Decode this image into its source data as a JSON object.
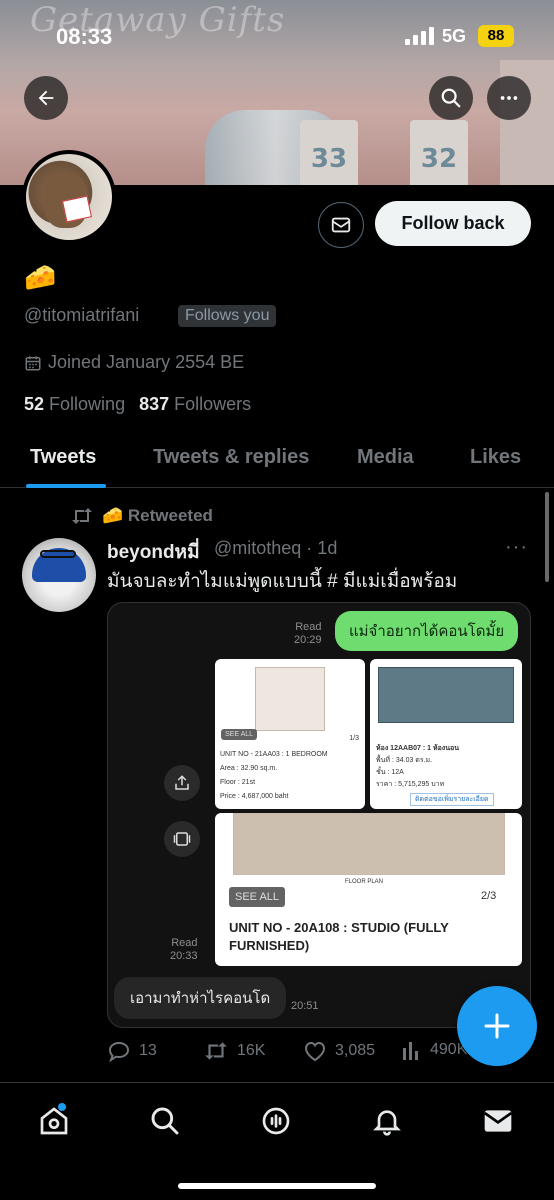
{
  "status_bar": {
    "time": "08:33",
    "network": "5G",
    "battery": "88"
  },
  "banner": {
    "sign_text": "Getaway Gifts",
    "pillar_left": "33",
    "pillar_right": "32"
  },
  "profile": {
    "display_name": "🧀",
    "handle": "@titomiatrifani",
    "follows_you": "Follows you",
    "joined": "Joined January 2554 BE",
    "following_count": "52",
    "following_label": "Following",
    "followers_count": "837",
    "followers_label": "Followers",
    "follow_button": "Follow back"
  },
  "tabs": [
    {
      "label": "Tweets"
    },
    {
      "label": "Tweets & replies"
    },
    {
      "label": "Media"
    },
    {
      "label": "Likes"
    }
  ],
  "tweet": {
    "retweeted_label": "🧀 Retweeted",
    "author_name": "beyondหมี่",
    "author_meta": "@mitotheq · 1d",
    "more": "···",
    "text": "มันจบละทำไมแม่พูดแบบนี้ # มีแม่เมื่อพร้อม",
    "media": {
      "green_bubble": "แม่จำอยากได้คอนโดมั้ย",
      "read1_label": "Read",
      "read1_time": "20:29",
      "doc1": {
        "see_all": "SEE ALL",
        "unit": "UNIT NO - 21AA03 : 1 BEDROOM",
        "area": "Area : 32.90 sq.m.",
        "floor": "Floor : 21st",
        "price": "Price : 4,687,000 baht",
        "page": "1/3"
      },
      "doc2": {
        "room": "ห้อง 12AAB07 : 1 ห้องนอน",
        "area": "พื้นที่ : 34.03 ตร.ม.",
        "floor": "ชั้น : 12A",
        "price": "ราคา : 5,715,295 บาท",
        "link": "ติดต่อขอเพิ่มรายละเอียด"
      },
      "doc3": {
        "see_all": "SEE ALL",
        "page": "2/3",
        "floor_label": "FLOOR PLAN",
        "unit": "UNIT NO - 20A108 : STUDIO (FULLY FURNISHED)"
      },
      "read2_label": "Read",
      "read2_time": "20:33",
      "gray_bubble": "เอามาทำห่าไรคอนโด",
      "gray_time": "20:51"
    },
    "replies": "13",
    "retweets": "16K",
    "likes": "3,085",
    "views": "490K"
  },
  "colors": {
    "accent": "#1d9bf0",
    "background": "#000000",
    "green_bubble": "#6fdc6f"
  }
}
